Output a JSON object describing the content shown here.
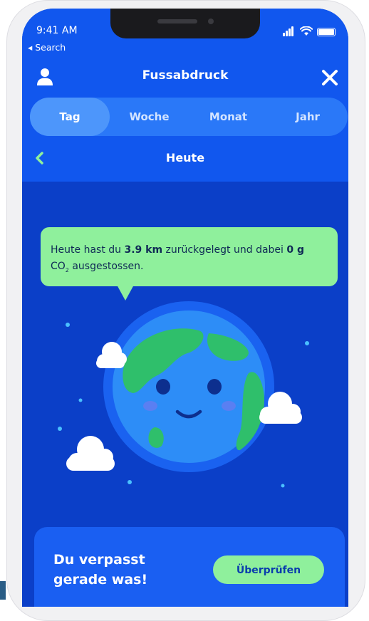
{
  "status_bar": {
    "time": "9:41 AM",
    "back_label": "◂ Search",
    "icons": [
      "signal-icon",
      "wifi-icon",
      "battery-icon"
    ]
  },
  "header": {
    "title": "Fussabdruck",
    "user_icon": "user-icon",
    "close_icon": "close-icon"
  },
  "tabs": [
    {
      "label": "Tag",
      "active": true
    },
    {
      "label": "Woche",
      "active": false
    },
    {
      "label": "Monat",
      "active": false
    },
    {
      "label": "Jahr",
      "active": false
    }
  ],
  "subheader": {
    "back_icon": "chevron-left-icon",
    "title": "Heute"
  },
  "bubble": {
    "prefix": "Heute hast du ",
    "distance": "3.9 km",
    "middle": " zurückgelegt und dabei ",
    "co2_amount": "0 g",
    "co2_main": "CO",
    "co2_sub": "2",
    "suffix": " ausgestossen."
  },
  "promo": {
    "text": "Du verpasst gerade was!",
    "button_label": "Überprüfen"
  },
  "colors": {
    "primary_blue": "#1157ee",
    "background_blue": "#0b3fc8",
    "accent_green": "#8ff09c",
    "earth_green": "#2fbf6b",
    "earth_blue": "#2d8df7"
  }
}
